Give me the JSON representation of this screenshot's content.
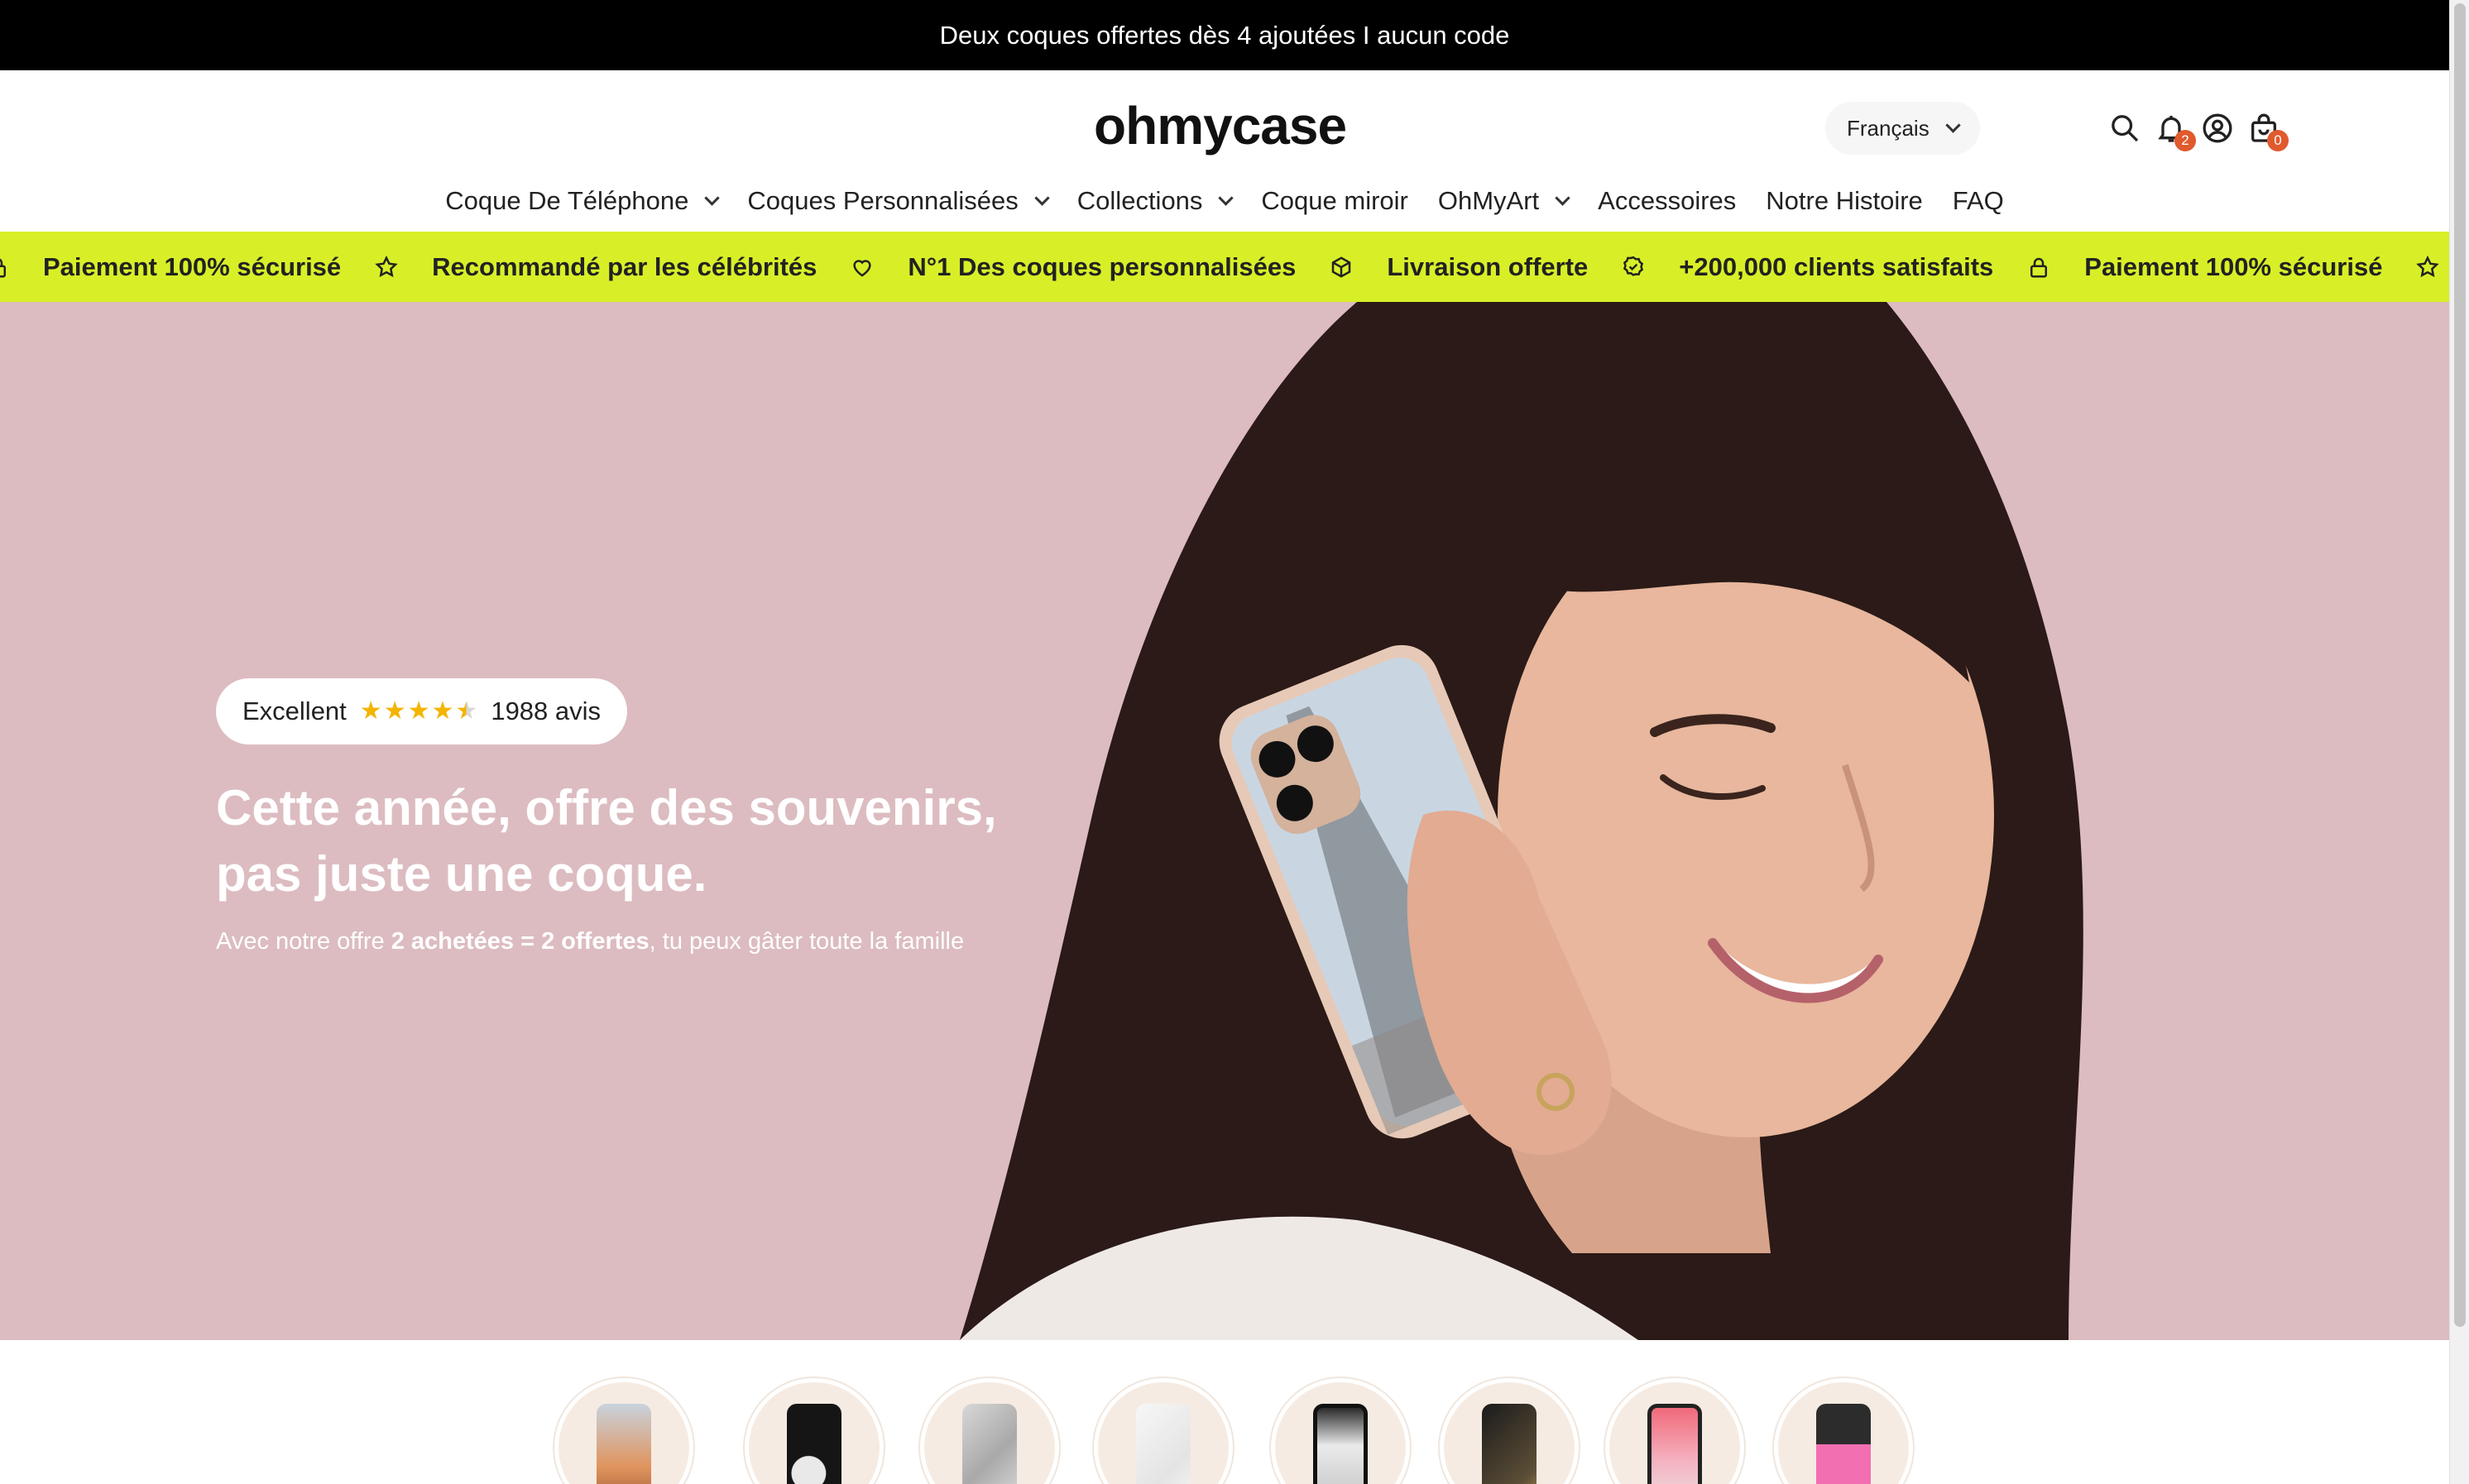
{
  "announcement": {
    "text": "Deux coques offertes dès 4 ajoutées I aucun code"
  },
  "header": {
    "logo": "ohmycase",
    "language": "Français",
    "notifications_count": "2",
    "cart_count": "0"
  },
  "nav": {
    "items": [
      {
        "label": "Coque De Téléphone",
        "has_dropdown": true
      },
      {
        "label": "Coques Personnalisées",
        "has_dropdown": true
      },
      {
        "label": "Collections",
        "has_dropdown": true
      },
      {
        "label": "Coque miroir",
        "has_dropdown": false
      },
      {
        "label": "OhMyArt",
        "has_dropdown": true
      },
      {
        "label": "Accessoires",
        "has_dropdown": false
      },
      {
        "label": "Notre Histoire",
        "has_dropdown": false
      },
      {
        "label": "FAQ",
        "has_dropdown": false
      }
    ]
  },
  "ticker": {
    "items": [
      {
        "label": "Paiement 100% sécurisé",
        "icon": "star-icon"
      },
      {
        "label": "Recommandé par les célébrités",
        "icon": "heart-icon"
      },
      {
        "label": "N°1 Des coques personnalisées",
        "icon": "box-icon"
      },
      {
        "label": "Livraison offerte",
        "icon": "verified-badge-icon"
      },
      {
        "label": "+200,000 clients satisfaits",
        "icon": "lock-icon"
      },
      {
        "label": "Paiement 100% sécurisé",
        "icon": "star-icon"
      }
    ]
  },
  "hero": {
    "rating_label": "Excellent",
    "rating_stars": 4.5,
    "reviews": "1988 avis",
    "title_line1": "Cette année, offre des souvenirs,",
    "title_line2": "pas juste une coque.",
    "subtitle_pre": "Avec notre offre ",
    "subtitle_bold": "2 achetées = 2 offertes",
    "subtitle_post": ", tu peux gâter toute la famille"
  },
  "colors": {
    "announcement_bg": "#000000",
    "ticker_bg": "#d8ef28",
    "hero_bg": "#dcbcc0",
    "badge": "#e05a2e",
    "star": "#f4b400"
  },
  "products": [
    {
      "name": "custom-photo-case",
      "icon": "phone-case-icon"
    },
    {
      "name": "black-cloud-case",
      "icon": "phone-case-icon"
    },
    {
      "name": "marble-case",
      "icon": "phone-case-icon"
    },
    {
      "name": "white-marble-case",
      "icon": "phone-case-icon"
    },
    {
      "name": "mirror-case",
      "icon": "phone-case-icon"
    },
    {
      "name": "ring-holder",
      "icon": "ring-icon"
    },
    {
      "name": "clear-case",
      "icon": "phone-case-icon"
    },
    {
      "name": "pink-card-holder",
      "icon": "phone-case-icon"
    }
  ]
}
